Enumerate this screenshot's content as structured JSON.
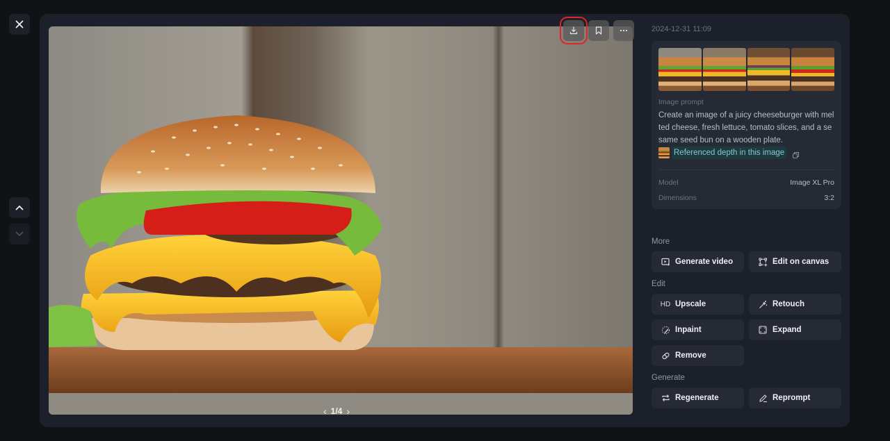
{
  "window": {
    "close_label": "Close",
    "nav_up": "Previous",
    "nav_down": "Next"
  },
  "image": {
    "description": "Cheeseburger with melted cheese, lettuce, tomato and sesame bun on a wooden plate",
    "actions": [
      {
        "name": "download",
        "icon": "download-icon",
        "highlighted": true
      },
      {
        "name": "bookmark",
        "icon": "bookmark-icon",
        "highlighted": false
      },
      {
        "name": "more",
        "icon": "more-icon",
        "highlighted": false
      }
    ],
    "pager": {
      "current": 1,
      "total": 4,
      "label": "1/4"
    }
  },
  "sidebar": {
    "timestamp": "2024-12-31 11:09",
    "thumbnails": [
      {
        "label": "Variant 1",
        "selected": true
      },
      {
        "label": "Variant 2",
        "selected": false
      },
      {
        "label": "Variant 3",
        "selected": false
      },
      {
        "label": "Variant 4",
        "selected": false
      }
    ],
    "prompt_label": "Image prompt",
    "prompt_text": "Create an image of a juicy cheeseburger with melted cheese, fresh lettuce, tomato slices, and a sesame seed bun on a wooden plate.",
    "reference_label": "Referenced depth in this image",
    "details": [
      {
        "key": "Model",
        "value": "Image XL Pro"
      },
      {
        "key": "Dimensions",
        "value": "3:2"
      }
    ],
    "sections": {
      "more": {
        "title": "More",
        "buttons": [
          {
            "label": "Generate video",
            "icon": "video-icon"
          },
          {
            "label": "Edit on canvas",
            "icon": "canvas-icon"
          }
        ]
      },
      "edit": {
        "title": "Edit",
        "buttons": [
          {
            "label": "Upscale",
            "icon": "hd-icon",
            "icon_text": "HD"
          },
          {
            "label": "Retouch",
            "icon": "wand-icon"
          },
          {
            "label": "Inpaint",
            "icon": "inpaint-icon"
          },
          {
            "label": "Expand",
            "icon": "expand-icon"
          },
          {
            "label": "Remove",
            "icon": "eraser-icon"
          }
        ]
      },
      "generate": {
        "title": "Generate",
        "buttons": [
          {
            "label": "Regenerate",
            "icon": "regenerate-icon"
          },
          {
            "label": "Reprompt",
            "icon": "pencil-icon"
          }
        ]
      }
    }
  },
  "colors": {
    "background": "#111216",
    "panel": "#1c202a",
    "card": "#262a35",
    "highlight": "#e0242a",
    "reference_chip": "#1d3a40",
    "reference_text": "#88c6cc"
  }
}
